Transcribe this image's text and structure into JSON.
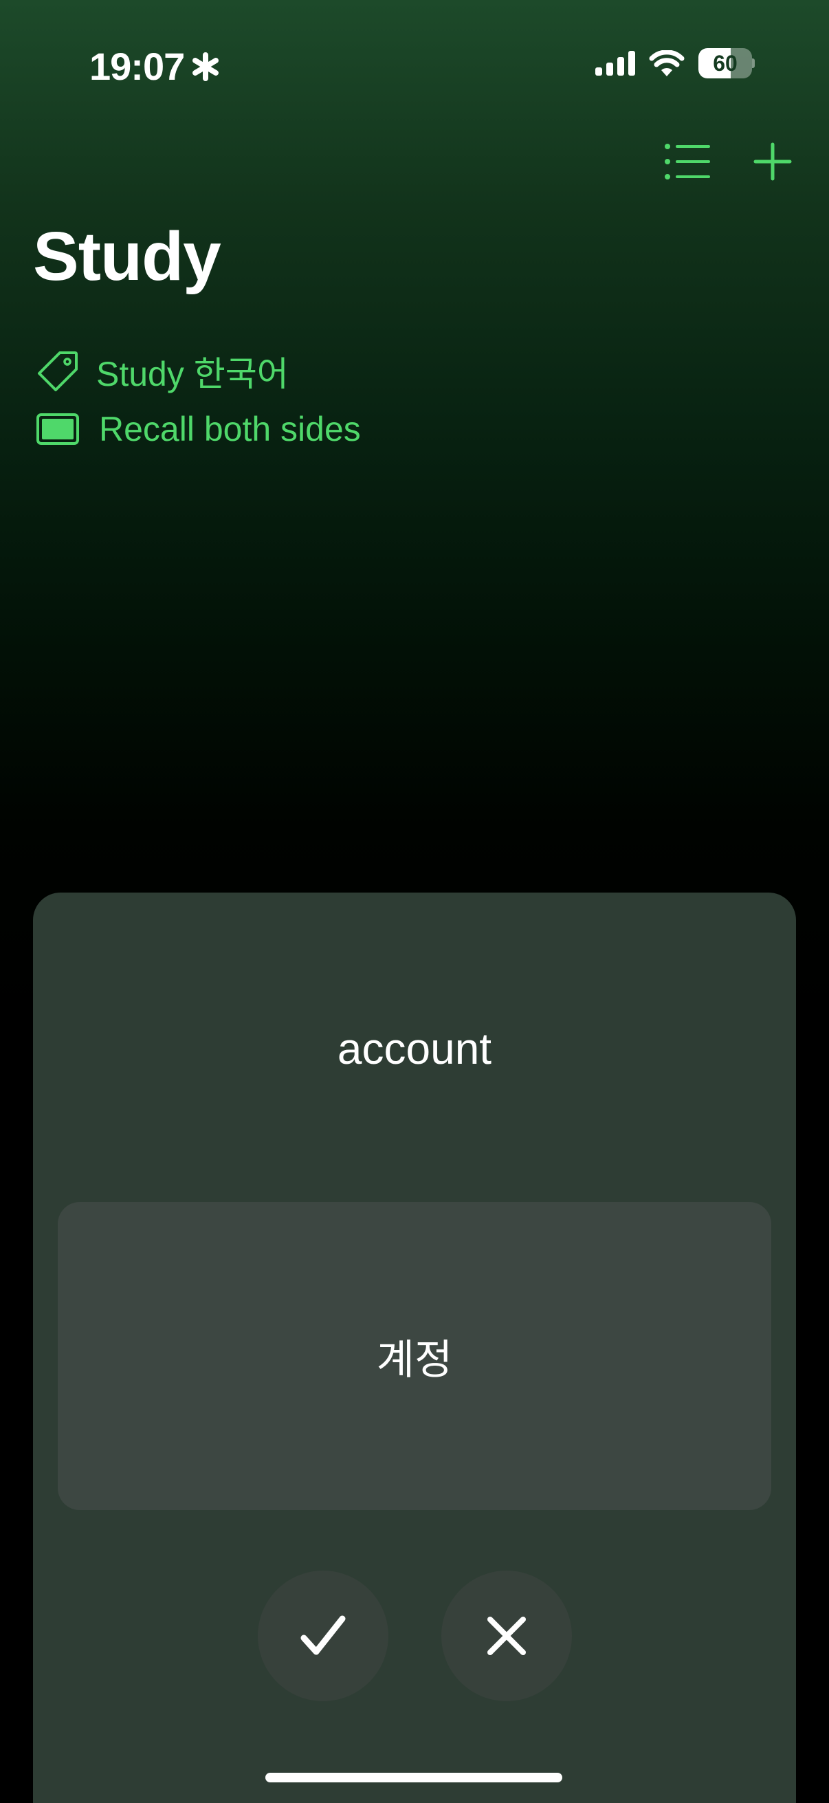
{
  "status_bar": {
    "time": "19:07",
    "focus_icon": "asterisk-icon",
    "cellular_icon": "signal-bars-icon",
    "wifi_icon": "wifi-icon",
    "battery_level": "60",
    "battery_fraction": 0.6
  },
  "toolbar": {
    "list_icon": "list-icon",
    "add_icon": "plus-icon"
  },
  "page": {
    "title": "Study"
  },
  "info": {
    "deck_icon": "tag-icon",
    "deck_label": "Study 한국어",
    "mode_icon": "card-rectangle-icon",
    "mode_label": "Recall both sides"
  },
  "card": {
    "front": "account",
    "back": "계정",
    "correct_icon": "checkmark-icon",
    "wrong_icon": "xmark-icon"
  },
  "colors": {
    "accent": "#4fd86a",
    "card_bg": "#2e3d34",
    "answer_bg": "#3d4742",
    "button_bg": "#37413b"
  }
}
